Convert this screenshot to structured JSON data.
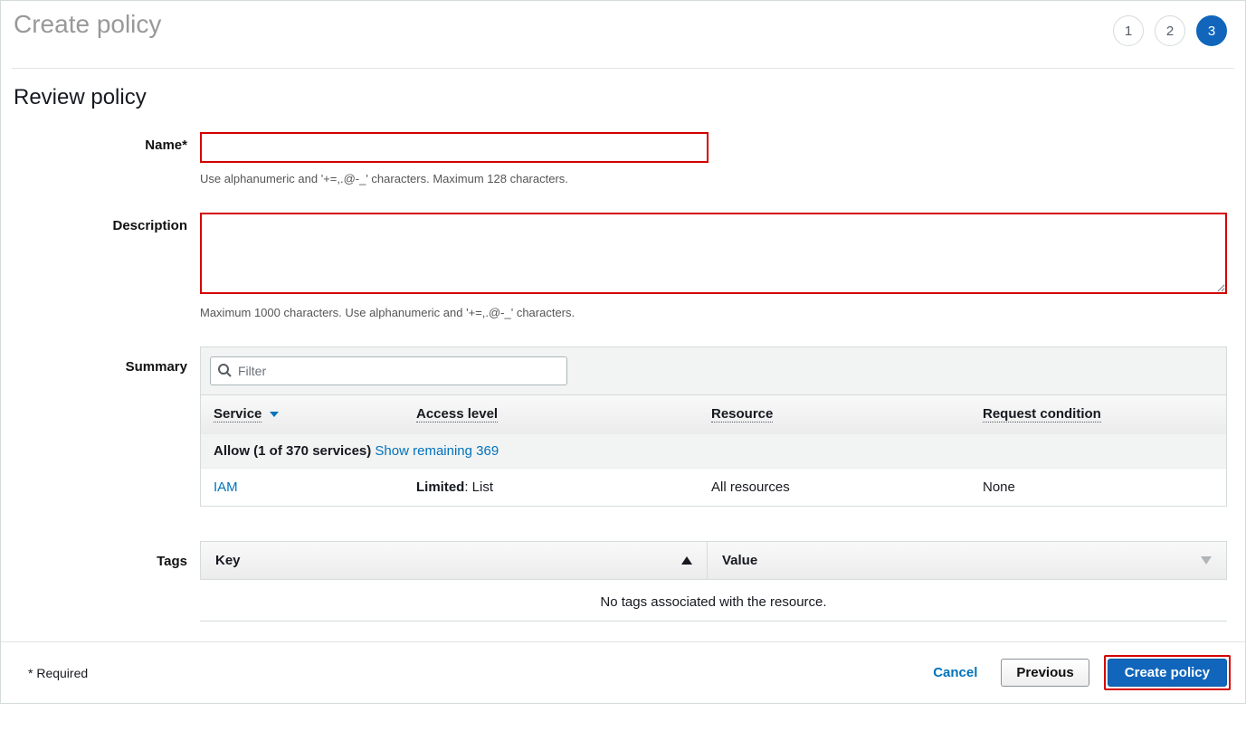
{
  "header": {
    "title": "Create policy",
    "steps": [
      "1",
      "2",
      "3"
    ],
    "activeStep": 2
  },
  "section_title": "Review policy",
  "name_row": {
    "label": "Name*",
    "value": "",
    "hint": "Use alphanumeric and '+=,.@-_' characters. Maximum 128 characters."
  },
  "description_row": {
    "label": "Description",
    "value": "",
    "hint": "Maximum 1000 characters. Use alphanumeric and '+=,.@-_' characters."
  },
  "summary": {
    "label": "Summary",
    "filter_placeholder": "Filter",
    "columns": {
      "service": "Service",
      "access": "Access level",
      "resource": "Resource",
      "reqcond": "Request condition"
    },
    "allow_text_bold": "Allow (1 of 370 services)",
    "allow_link": "Show remaining 369",
    "row": {
      "service": "IAM",
      "access_bold": "Limited",
      "access_rest": ": List",
      "resource": "All resources",
      "reqcond": "None"
    }
  },
  "tags": {
    "label": "Tags",
    "col_key": "Key",
    "col_value": "Value",
    "empty": "No tags associated with the resource."
  },
  "footer": {
    "required": "* Required",
    "cancel": "Cancel",
    "previous": "Previous",
    "create": "Create policy"
  }
}
